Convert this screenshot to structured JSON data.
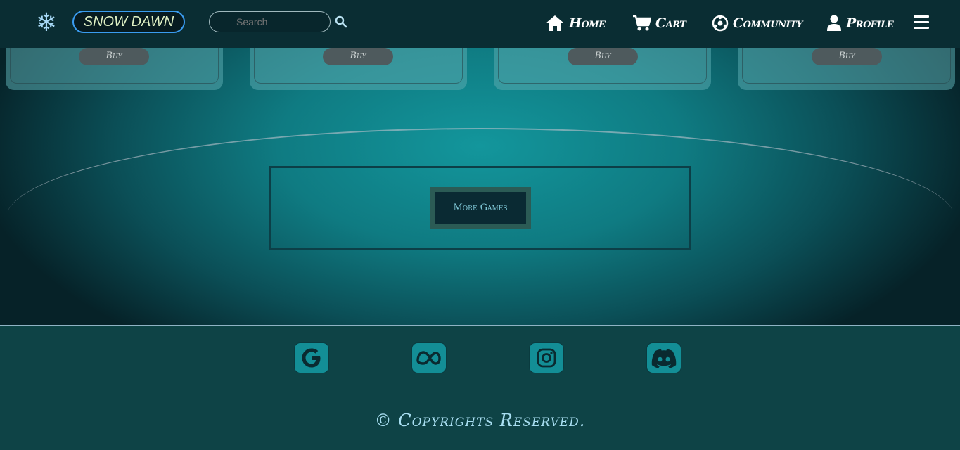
{
  "navbar": {
    "brand": "SNOW DAWN",
    "logo_icon": "snowflake-icon",
    "search_placeholder": "Search",
    "items": [
      {
        "label": "Home",
        "icon": "home-icon"
      },
      {
        "label": "Cart",
        "icon": "cart-icon"
      },
      {
        "label": "Community",
        "icon": "community-icon"
      },
      {
        "label": "Profile",
        "icon": "user-icon"
      }
    ],
    "menu_icon": "hamburger-menu-icon"
  },
  "cards": [
    {
      "buy_label": "Buy"
    },
    {
      "buy_label": "Buy"
    },
    {
      "buy_label": "Buy"
    },
    {
      "buy_label": "Buy"
    }
  ],
  "more_games_label": "More Games",
  "footer": {
    "social": [
      "google-icon",
      "meta-icon",
      "instagram-icon",
      "discord-icon"
    ],
    "copyright": "© Copyrights Reserved."
  },
  "colors": {
    "navbar_bg": "#0a2d33",
    "accent_teal": "#138e96",
    "footer_bg": "#0e4346",
    "brand_border": "#3a9cf0"
  }
}
